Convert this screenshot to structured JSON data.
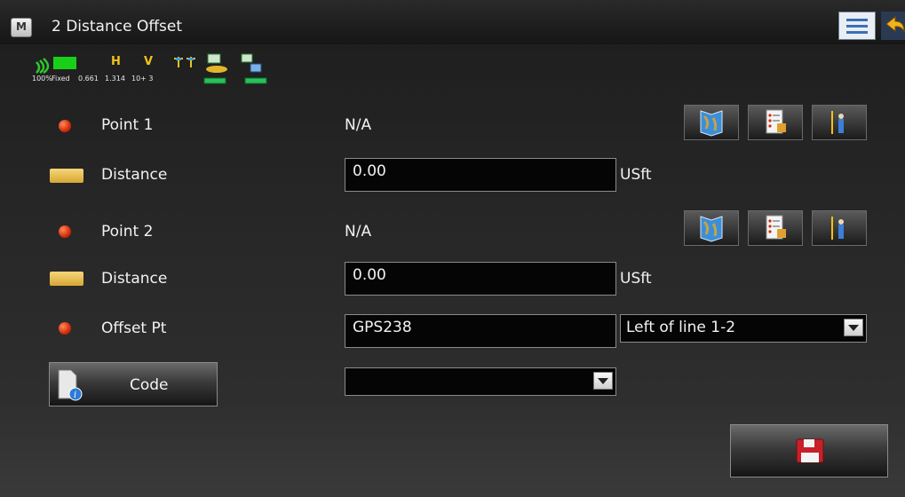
{
  "window": {
    "title": "2 Distance Offset",
    "logo_letter": "M"
  },
  "status": {
    "signal_percent": "100%",
    "solution": "Fixed",
    "h_label": "H",
    "v_label": "V",
    "h_value": "0.661",
    "v_value": "1.314",
    "satellites": "10+ 3"
  },
  "rows": {
    "point1": {
      "label": "Point 1",
      "value": "N/A"
    },
    "distance1": {
      "label": "Distance",
      "value": "0.00",
      "unit": "USft"
    },
    "point2": {
      "label": "Point 2",
      "value": "N/A"
    },
    "distance2": {
      "label": "Distance",
      "value": "0.00",
      "unit": "USft"
    },
    "offset": {
      "label": "Offset Pt",
      "value": "GPS238",
      "direction": "Left of line 1-2"
    },
    "code": {
      "button_label": "Code",
      "value": ""
    }
  },
  "icons": {
    "map": "map-icon",
    "list": "point-list-icon",
    "measure": "survey-rod-icon",
    "save": "save-floppy-icon"
  },
  "colors": {
    "point_dot": "#d32b0a",
    "ruler": "#e0b547",
    "accent_green": "#2ec82e"
  }
}
